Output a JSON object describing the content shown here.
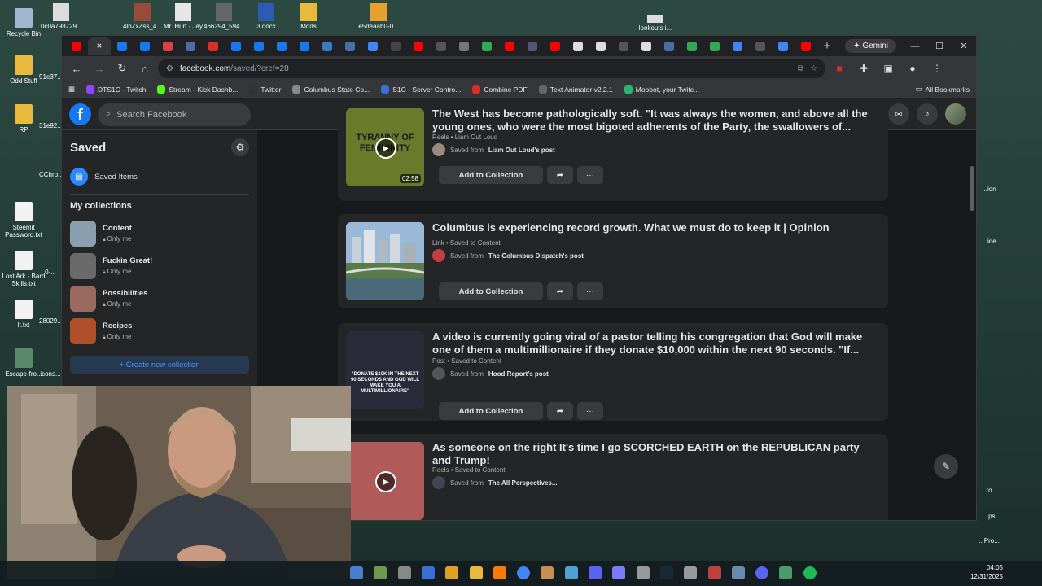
{
  "desktop": {
    "left_icons": [
      {
        "label": "Recycle Bin",
        "color": "#9fb7d0"
      },
      {
        "label": "Odd Stuff",
        "color": "#e8b93b"
      },
      {
        "label": "RP",
        "color": "#e8b93b"
      },
      {
        "label": "Steemit Password.txt",
        "color": "#f2f2f2"
      },
      {
        "label": "Lost Ark - Bard Skills.txt",
        "color": "#f2f2f2"
      },
      {
        "label": "lt.txt",
        "color": "#f2f2f2"
      },
      {
        "label": "Escape-fro...",
        "color": "#5a8a6a"
      }
    ],
    "partial_icons": [
      "91e37...",
      "31e92...",
      "CChro...",
      "0-...",
      "28029...",
      "icons..."
    ],
    "top_icons": [
      {
        "label": "0c0a798729...",
        "color": "#dcdcdc"
      },
      {
        "label": "4lhZxZss_4...",
        "color": "#9a4a3a"
      },
      {
        "label": "Mr. Hurt - Jay",
        "color": "#e6e6e6"
      },
      {
        "label": "466294_594...",
        "color": "#666666"
      },
      {
        "label": "3.docx",
        "color": "#2b5bb5"
      },
      {
        "label": "Mods",
        "color": "#e8b93b"
      },
      {
        "label": "e5deaab0-0...",
        "color": "#e8a030"
      },
      {
        "label": "lookouts i...",
        "color": "#dddddd"
      }
    ],
    "right_partial": [
      "...ion",
      "...ide",
      "...ro...",
      "...ps",
      "...Pro..."
    ]
  },
  "browser": {
    "tabs": [
      {
        "icon": "youtube-icon",
        "color": "#ff0000"
      },
      {
        "icon": "close-icon",
        "color": "#35363a",
        "active": true
      },
      {
        "icon": "facebook-icon",
        "color": "#1877f2"
      },
      {
        "icon": "facebook-icon",
        "color": "#1877f2"
      },
      {
        "icon": "red-icon",
        "color": "#e04040"
      },
      {
        "icon": "settings-icon",
        "color": "#4a6fa5"
      },
      {
        "icon": "pdf-icon",
        "color": "#d93025"
      },
      {
        "icon": "facebook-icon",
        "color": "#1877f2"
      },
      {
        "icon": "facebook-icon",
        "color": "#1877f2"
      },
      {
        "icon": "facebook-icon",
        "color": "#1877f2"
      },
      {
        "icon": "facebook-icon",
        "color": "#1877f2"
      },
      {
        "icon": "link-icon",
        "color": "#3a7ac0"
      },
      {
        "icon": "settings-icon",
        "color": "#4a6fa5"
      },
      {
        "icon": "google-icon",
        "color": "#4285f4"
      },
      {
        "icon": "x-icon",
        "color": "#444444"
      },
      {
        "icon": "youtube-icon",
        "color": "#ff0000"
      },
      {
        "icon": "doc-icon",
        "color": "#555555"
      },
      {
        "icon": "chatgpt-icon",
        "color": "#777777"
      },
      {
        "icon": "play-icon",
        "color": "#34a853"
      },
      {
        "icon": "youtube-icon",
        "color": "#ff0000"
      },
      {
        "icon": "steam-icon",
        "color": "#555577"
      },
      {
        "icon": "youtube-icon",
        "color": "#ff0000"
      },
      {
        "icon": "wikipedia-icon",
        "color": "#dddddd"
      },
      {
        "icon": "wikipedia-icon",
        "color": "#dddddd"
      },
      {
        "icon": "doc-icon",
        "color": "#555555"
      },
      {
        "icon": "wikipedia-icon",
        "color": "#dddddd"
      },
      {
        "icon": "settings-icon",
        "color": "#4a6fa5"
      },
      {
        "icon": "maps-icon",
        "color": "#34a853"
      },
      {
        "icon": "maps-icon",
        "color": "#34a853"
      },
      {
        "icon": "google-icon",
        "color": "#4285f4"
      },
      {
        "icon": "d-icon",
        "color": "#555555"
      },
      {
        "icon": "google-icon",
        "color": "#4285f4"
      },
      {
        "icon": "youtube-icon",
        "color": "#ff0000"
      }
    ],
    "new_tab_label": "+",
    "gemini_label": "✦ Gemini",
    "url": "facebook.com",
    "url_rest": "/saved/?cref=28",
    "bookmarks": [
      {
        "label": "DTS1C - Twitch",
        "color": "#9146ff"
      },
      {
        "label": "Stream - Kick Dashb...",
        "color": "#53fc18"
      },
      {
        "label": "Twitter",
        "color": "#333333"
      },
      {
        "label": "Columbus State Co...",
        "color": "#888888"
      },
      {
        "label": "S1C - Server Contro...",
        "color": "#3a6fd8"
      },
      {
        "label": "Combine PDF",
        "color": "#d93025"
      },
      {
        "label": "Text Animator v2.2.1",
        "color": "#666666"
      },
      {
        "label": "Moobot, your Twitc...",
        "color": "#2bb673"
      }
    ],
    "all_bookmarks_label": "All Bookmarks"
  },
  "facebook": {
    "search_placeholder": "Search Facebook",
    "sidebar": {
      "title": "Saved",
      "saved_items_label": "Saved Items",
      "my_collections_label": "My collections",
      "collections": [
        {
          "title": "Content",
          "privacy": "Only me",
          "color": "#8aa0b0"
        },
        {
          "title": "Fuckin Great!",
          "privacy": "Only me",
          "color": "#6a6a6a"
        },
        {
          "title": "Possibilities",
          "privacy": "Only me",
          "color": "#9a6a60"
        },
        {
          "title": "Recipes",
          "privacy": "Only me",
          "color": "#b0502a"
        }
      ],
      "create_label": "+ Create new collection"
    },
    "items": [
      {
        "title": "The West has become pathologically soft. \"It was always the women, and above all the young ones, who were the most bigoted adherents of the Party, the swallowers of...",
        "meta": "Reels • Liam Out Loud",
        "saved_from_prefix": "Saved from",
        "saved_from": "Liam Out Loud's post",
        "thumb_text": "TYRANNY OF FEMININITY",
        "duration": "02:58",
        "thumb_color": "#6b7a2a",
        "add_label": "Add to Collection"
      },
      {
        "title": "Columbus is experiencing record growth. What we must do to keep it | Opinion",
        "meta": "Link • Saved to Content",
        "saved_from_prefix": "Saved from",
        "saved_from": "The Columbus Dispatch's post",
        "thumb_color": "#6a8ab0",
        "add_label": "Add to Collection"
      },
      {
        "title": "A video is currently going viral of a pastor telling his congregation that God will make one of them a multimillionaire if they donate $10,000 within the next 90 seconds. \"If...",
        "meta": "Post • Saved to Content",
        "saved_from_prefix": "Saved from",
        "saved_from": "Hood Report's post",
        "thumb_text": "\"DONATE $10K IN THE NEXT 90 SECONDS AND GOD WILL MAKE YOU A MULTIMILLIONAIRE\"",
        "thumb_color": "#2a2a3a",
        "add_label": "Add to Collection"
      },
      {
        "title": "As someone on the right It's time I go SCORCHED EARTH on the REPUBLICAN party and Trump!",
        "meta": "Reels • Saved to Content",
        "saved_from_prefix": "Saved from",
        "saved_from": "The All Perspectives...",
        "thumb_color": "#b05a5a",
        "add_label": "Add to Collection"
      }
    ]
  },
  "taskbar": {
    "time": "04:05",
    "date": "12/31/2025"
  }
}
